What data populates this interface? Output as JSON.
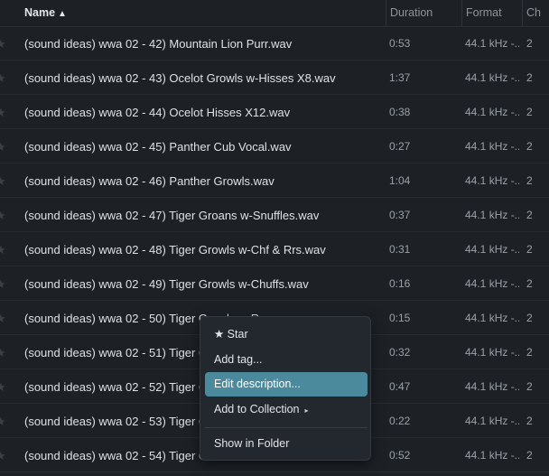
{
  "columns": {
    "name": "Name",
    "sort_indicator": "▲",
    "duration": "Duration",
    "format": "Format",
    "channels": "Ch"
  },
  "star_glyph": "★",
  "rows": [
    {
      "name": "(sound ideas) wwa 02 - 42) Mountain Lion Purr.wav",
      "duration": "0:53",
      "format": "44.1 kHz -...",
      "channels": "2"
    },
    {
      "name": "(sound ideas) wwa 02 - 43) Ocelot Growls w-Hisses X8.wav",
      "duration": "1:37",
      "format": "44.1 kHz -...",
      "channels": "2"
    },
    {
      "name": "(sound ideas) wwa 02 - 44) Ocelot Hisses X12.wav",
      "duration": "0:38",
      "format": "44.1 kHz -...",
      "channels": "2"
    },
    {
      "name": "(sound ideas) wwa 02 - 45) Panther Cub Vocal.wav",
      "duration": "0:27",
      "format": "44.1 kHz -...",
      "channels": "2"
    },
    {
      "name": "(sound ideas) wwa 02 - 46) Panther Growls.wav",
      "duration": "1:04",
      "format": "44.1 kHz -...",
      "channels": "2"
    },
    {
      "name": "(sound ideas) wwa 02 - 47) Tiger Groans w-Snuffles.wav",
      "duration": "0:37",
      "format": "44.1 kHz -...",
      "channels": "2"
    },
    {
      "name": "(sound ideas) wwa 02 - 48) Tiger Growls w-Chf & Rrs.wav",
      "duration": "0:31",
      "format": "44.1 kHz -...",
      "channels": "2"
    },
    {
      "name": "(sound ideas) wwa 02 - 49) Tiger Growls w-Chuffs.wav",
      "duration": "0:16",
      "format": "44.1 kHz -...",
      "channels": "2"
    },
    {
      "name": "(sound ideas) wwa 02 - 50) Tiger Growls w-Roars.wav",
      "duration": "0:15",
      "format": "44.1 kHz -...",
      "channels": "2"
    },
    {
      "name": "(sound ideas) wwa 02 - 51) Tiger G",
      "duration": "0:32",
      "format": "44.1 kHz -...",
      "channels": "2"
    },
    {
      "name": "(sound ideas) wwa 02 - 52) Tiger G",
      "duration": "0:47",
      "format": "44.1 kHz -...",
      "channels": "2"
    },
    {
      "name": "(sound ideas) wwa 02 - 53) Tiger G",
      "duration": "0:22",
      "format": "44.1 kHz -...",
      "channels": "2"
    },
    {
      "name": "(sound ideas) wwa 02 - 54) Tiger G",
      "duration": "0:52",
      "format": "44.1 kHz -...",
      "channels": "2"
    }
  ],
  "context_menu": {
    "star": "★ Star",
    "add_tag": "Add tag...",
    "edit_description": "Edit description...",
    "add_to_collection": "Add to Collection",
    "submenu_arrow": "▸",
    "show_in_folder": "Show in Folder"
  },
  "colors": {
    "background": "#1d2126",
    "menu_highlight": "#4b8a9c",
    "text": "#dde1e5",
    "muted_text": "#9aa1a9"
  }
}
